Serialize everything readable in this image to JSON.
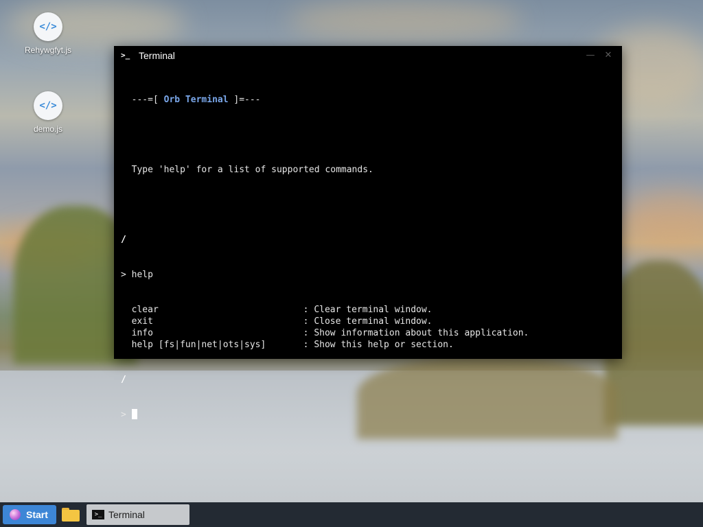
{
  "desktop": {
    "icons": [
      {
        "label": "Rehywgfyt.js",
        "icon": "code-file-icon"
      },
      {
        "label": "demo.js",
        "icon": "code-file-icon"
      }
    ]
  },
  "window": {
    "title": "Terminal",
    "icon": "terminal-icon",
    "controls": {
      "minimize": "minimize-icon",
      "close": "close-icon"
    }
  },
  "terminal": {
    "banner_prefix": "---=[ ",
    "banner_name": "Orb Terminal",
    "banner_suffix": " ]=---",
    "intro": "Type 'help' for a list of supported commands.",
    "slash": "/",
    "prompt": ">",
    "command": "help",
    "help_rows": [
      {
        "cmd": "clear",
        "desc": "Clear terminal window."
      },
      {
        "cmd": "exit",
        "desc": "Close terminal window."
      },
      {
        "cmd": "info",
        "desc": "Show information about this application."
      },
      {
        "cmd": "help [fs|fun|net|ots|sys]",
        "desc": "Show this help or section."
      }
    ],
    "separator": ":"
  },
  "taskbar": {
    "start_label": "Start",
    "folder_icon": "folder-icon",
    "tasks": [
      {
        "label": "Terminal",
        "icon": "terminal-icon"
      }
    ]
  },
  "colors": {
    "accent": "#7aa7ea",
    "start_button": "#3d86d6",
    "taskbar": "#232a33",
    "terminal_bg": "#000000"
  }
}
